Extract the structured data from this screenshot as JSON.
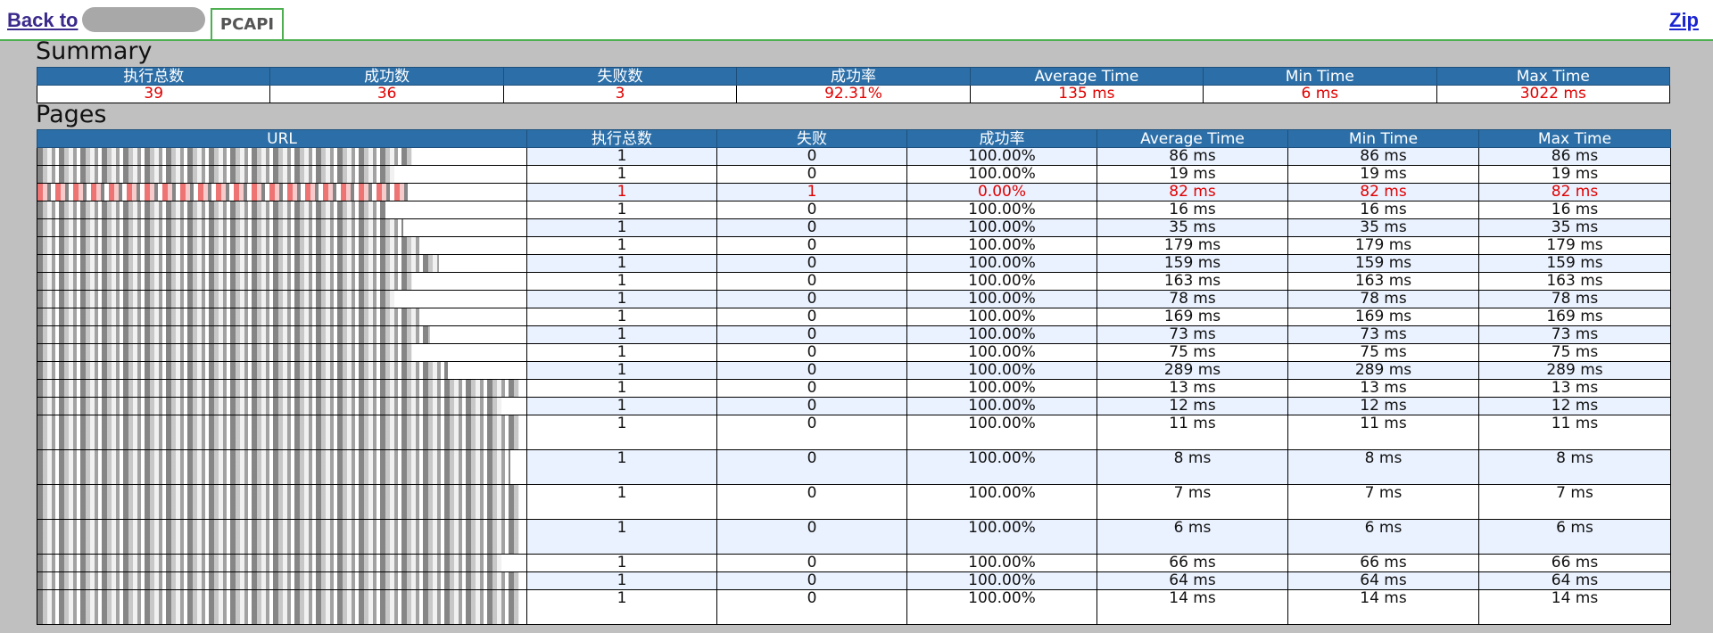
{
  "header": {
    "back_label": "Back to",
    "tab_label": "PCAPI",
    "zip_label": "Zip"
  },
  "summary": {
    "title": "Summary",
    "columns": [
      "执行总数",
      "成功数",
      "失败数",
      "成功率",
      "Average Time",
      "Min Time",
      "Max Time"
    ],
    "values": [
      "39",
      "36",
      "3",
      "92.31%",
      "135 ms",
      "6 ms",
      "3022 ms"
    ]
  },
  "pages": {
    "title": "Pages",
    "columns": [
      "URL",
      "执行总数",
      "失败",
      "成功率",
      "Average Time",
      "Min Time",
      "Max Time"
    ],
    "rows": [
      {
        "total": "1",
        "fail": "0",
        "rate": "100.00%",
        "avg": "86 ms",
        "min": "86 ms",
        "max": "86 ms"
      },
      {
        "total": "1",
        "fail": "0",
        "rate": "100.00%",
        "avg": "19 ms",
        "min": "19 ms",
        "max": "19 ms"
      },
      {
        "total": "1",
        "fail": "1",
        "rate": "0.00%",
        "avg": "82 ms",
        "min": "82 ms",
        "max": "82 ms",
        "failed": true
      },
      {
        "total": "1",
        "fail": "0",
        "rate": "100.00%",
        "avg": "16 ms",
        "min": "16 ms",
        "max": "16 ms"
      },
      {
        "total": "1",
        "fail": "0",
        "rate": "100.00%",
        "avg": "35 ms",
        "min": "35 ms",
        "max": "35 ms"
      },
      {
        "total": "1",
        "fail": "0",
        "rate": "100.00%",
        "avg": "179 ms",
        "min": "179 ms",
        "max": "179 ms"
      },
      {
        "total": "1",
        "fail": "0",
        "rate": "100.00%",
        "avg": "159 ms",
        "min": "159 ms",
        "max": "159 ms"
      },
      {
        "total": "1",
        "fail": "0",
        "rate": "100.00%",
        "avg": "163 ms",
        "min": "163 ms",
        "max": "163 ms"
      },
      {
        "total": "1",
        "fail": "0",
        "rate": "100.00%",
        "avg": "78 ms",
        "min": "78 ms",
        "max": "78 ms"
      },
      {
        "total": "1",
        "fail": "0",
        "rate": "100.00%",
        "avg": "169 ms",
        "min": "169 ms",
        "max": "169 ms"
      },
      {
        "total": "1",
        "fail": "0",
        "rate": "100.00%",
        "avg": "73 ms",
        "min": "73 ms",
        "max": "73 ms"
      },
      {
        "total": "1",
        "fail": "0",
        "rate": "100.00%",
        "avg": "75 ms",
        "min": "75 ms",
        "max": "75 ms"
      },
      {
        "total": "1",
        "fail": "0",
        "rate": "100.00%",
        "avg": "289 ms",
        "min": "289 ms",
        "max": "289 ms"
      },
      {
        "total": "1",
        "fail": "0",
        "rate": "100.00%",
        "avg": "13 ms",
        "min": "13 ms",
        "max": "13 ms"
      },
      {
        "total": "1",
        "fail": "0",
        "rate": "100.00%",
        "avg": "12 ms",
        "min": "12 ms",
        "max": "12 ms"
      },
      {
        "total": "1",
        "fail": "0",
        "rate": "100.00%",
        "avg": "11 ms",
        "min": "11 ms",
        "max": "11 ms",
        "tall": true
      },
      {
        "total": "1",
        "fail": "0",
        "rate": "100.00%",
        "avg": "8 ms",
        "min": "8 ms",
        "max": "8 ms",
        "tall": true
      },
      {
        "total": "1",
        "fail": "0",
        "rate": "100.00%",
        "avg": "7 ms",
        "min": "7 ms",
        "max": "7 ms",
        "tall": true
      },
      {
        "total": "1",
        "fail": "0",
        "rate": "100.00%",
        "avg": "6 ms",
        "min": "6 ms",
        "max": "6 ms",
        "tall": true
      },
      {
        "total": "1",
        "fail": "0",
        "rate": "100.00%",
        "avg": "66 ms",
        "min": "66 ms",
        "max": "66 ms"
      },
      {
        "total": "1",
        "fail": "0",
        "rate": "100.00%",
        "avg": "64 ms",
        "min": "64 ms",
        "max": "64 ms"
      },
      {
        "total": "1",
        "fail": "0",
        "rate": "100.00%",
        "avg": "14 ms",
        "min": "14 ms",
        "max": "14 ms",
        "tall": true
      }
    ]
  },
  "colors": {
    "header_bg": "#2c6fa8",
    "fail_text": "#e00000",
    "page_bg": "#c0c0c0",
    "row_alt": "#eaf2ff",
    "tab_border": "#4caf50"
  }
}
